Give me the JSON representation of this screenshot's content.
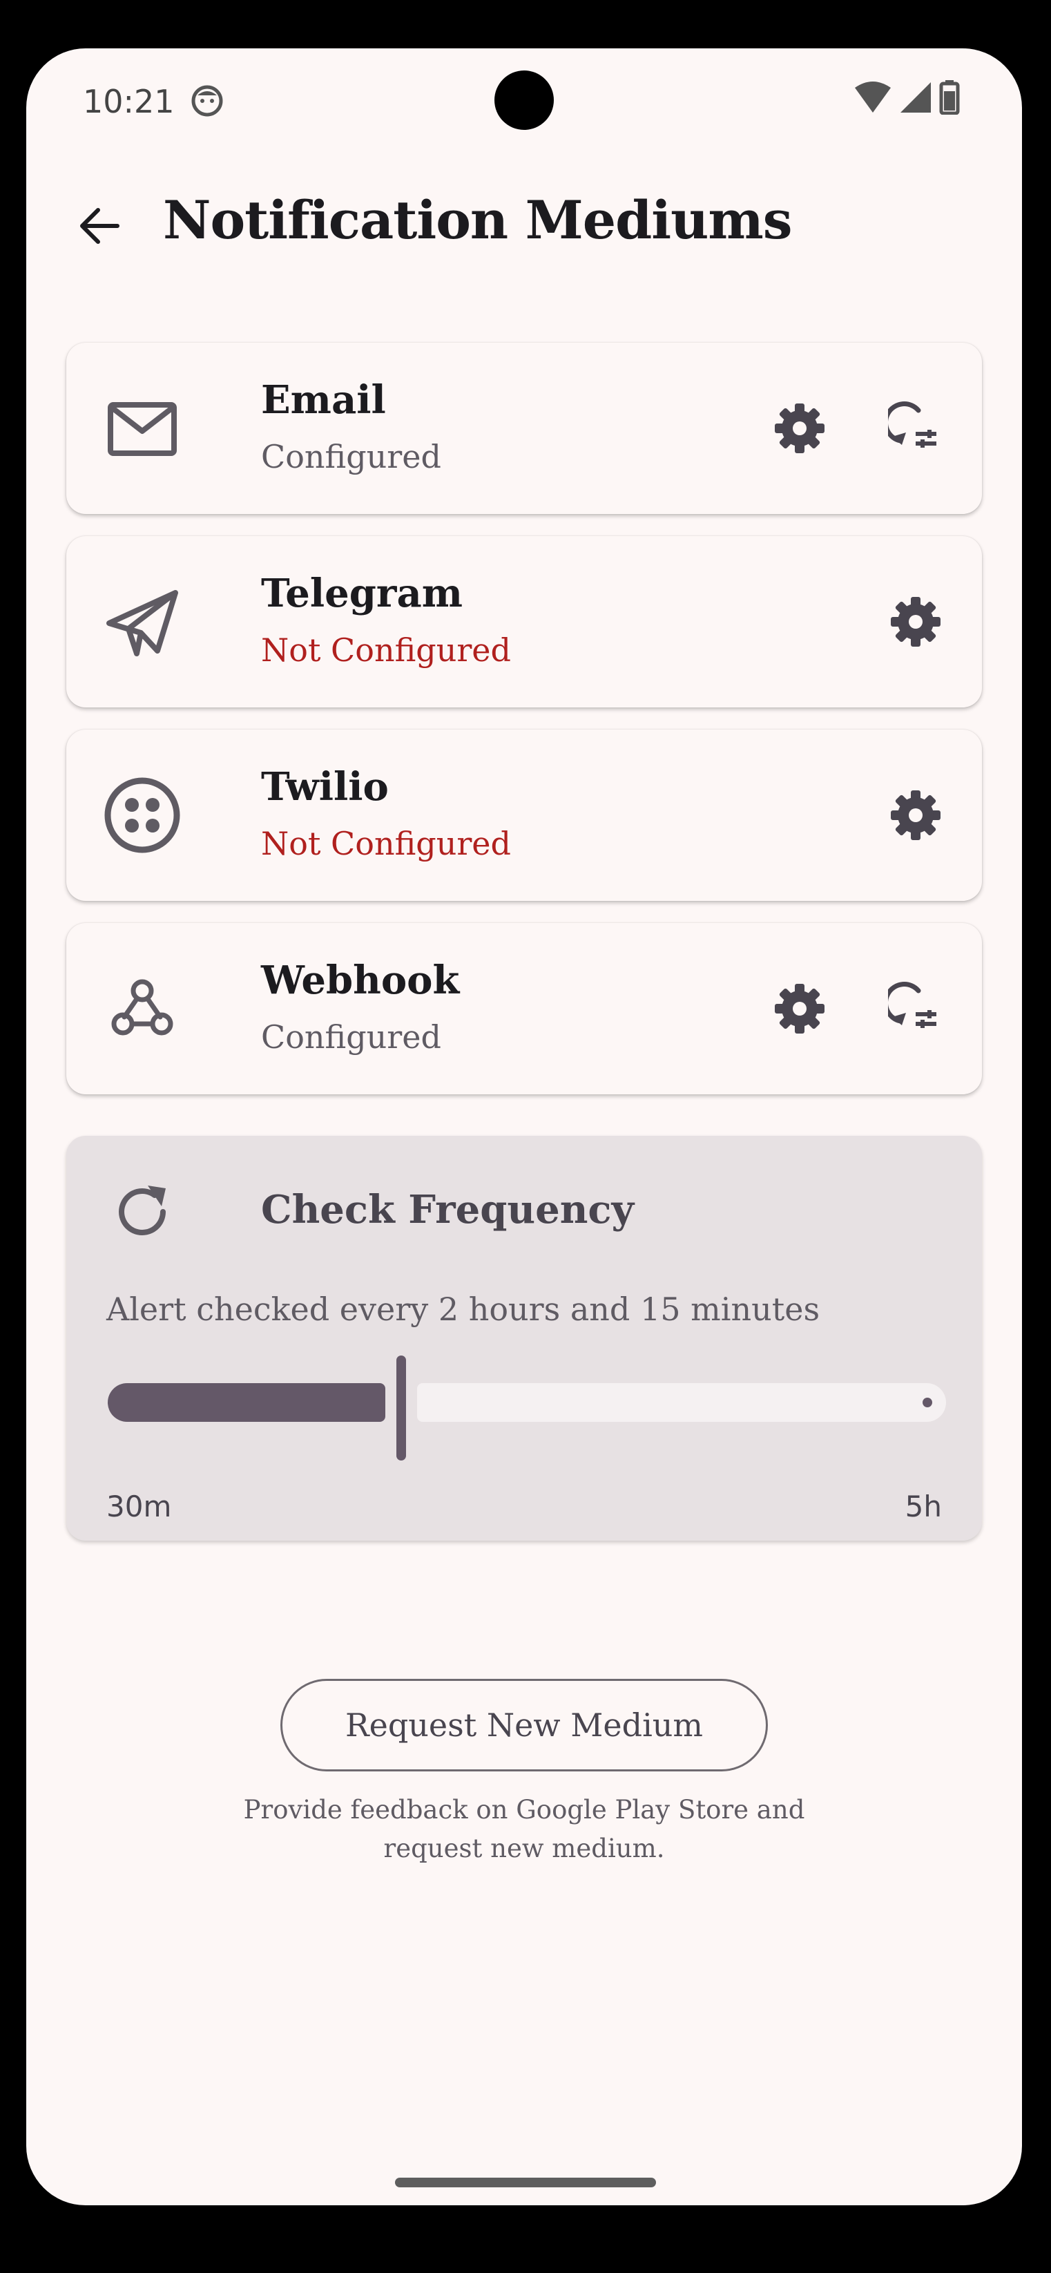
{
  "status_bar": {
    "time": "10:21"
  },
  "header": {
    "title": "Notification Mediums"
  },
  "mediums": [
    {
      "name": "Email",
      "status": "Configured",
      "configured": true,
      "icon": "mail-icon"
    },
    {
      "name": "Telegram",
      "status": "Not Configured",
      "configured": false,
      "icon": "send-icon"
    },
    {
      "name": "Twilio",
      "status": "Not Configured",
      "configured": false,
      "icon": "twilio-icon"
    },
    {
      "name": "Webhook",
      "status": "Configured",
      "configured": true,
      "icon": "webhook-icon"
    }
  ],
  "check_frequency": {
    "title": "Check Frequency",
    "description": "Alert checked every 2 hours and 15 minutes",
    "slider_min_label": "30m",
    "slider_max_label": "5h",
    "slider_fraction": 0.35
  },
  "request": {
    "button_label": "Request New Medium",
    "help_line1": "Provide feedback on Google Play Store and",
    "help_line2": "request new medium."
  },
  "colors": {
    "background": "#fdf7f6",
    "accent": "#645868",
    "error": "#b0201e"
  }
}
